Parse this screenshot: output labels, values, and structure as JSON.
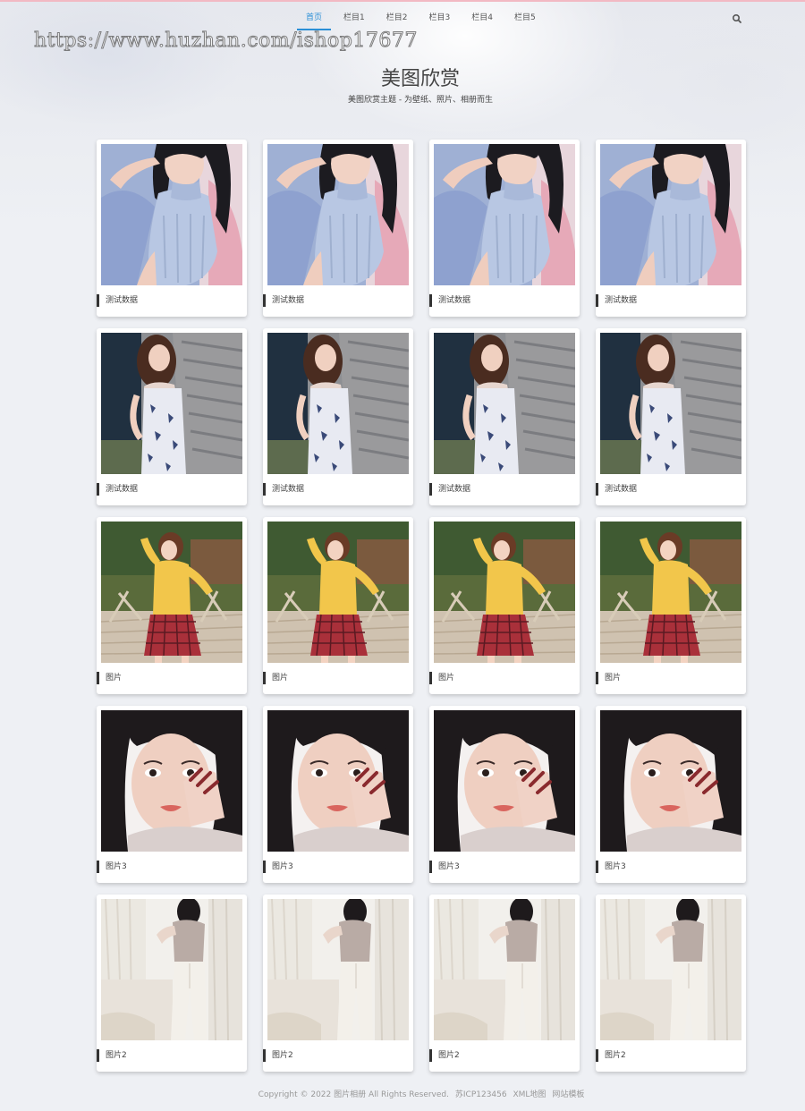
{
  "nav": {
    "items": [
      {
        "label": "首页",
        "active": true
      },
      {
        "label": "栏目1",
        "active": false
      },
      {
        "label": "栏目2",
        "active": false
      },
      {
        "label": "栏目3",
        "active": false
      },
      {
        "label": "栏目4",
        "active": false
      },
      {
        "label": "栏目5",
        "active": false
      }
    ],
    "search_icon": "search-icon",
    "accent_color": "#2b8fd6"
  },
  "watermark": "https://www.huzhan.com/ishop17677",
  "header": {
    "title": "美图欣赏",
    "subtitle": "美图欣赏主题 - 为壁纸、照片、相册而生"
  },
  "gallery": {
    "rows": [
      {
        "caption": "测试数据",
        "photo": "woman-in-blue-knit-top"
      },
      {
        "caption": "测试数据",
        "photo": "woman-in-floral-dress"
      },
      {
        "caption": "图片",
        "photo": "woman-in-yellow-top-plaid-skirt"
      },
      {
        "caption": "图片3",
        "photo": "woman-close-up-portrait"
      },
      {
        "caption": "图片2",
        "photo": "woman-in-white-pants"
      }
    ]
  },
  "footer": {
    "copyright": "Copyright © 2022 图片相册 All Rights Reserved.",
    "icp": "苏ICP123456",
    "sitemap": "XML地图",
    "template": "网站模板"
  }
}
